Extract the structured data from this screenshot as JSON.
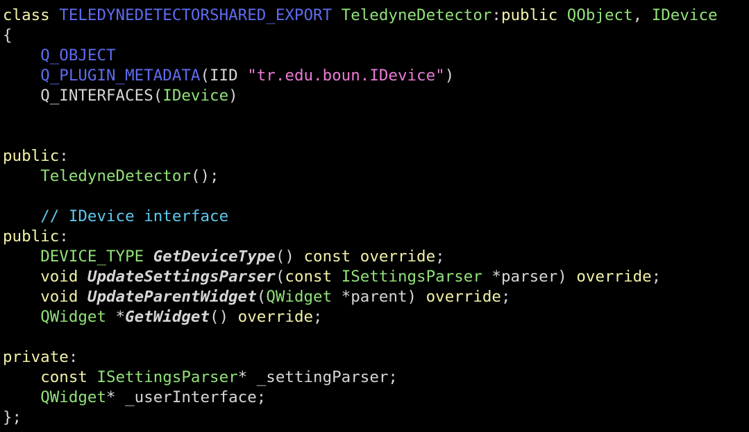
{
  "editor": {
    "colors": {
      "background": "#000000",
      "keyword": "#f4f1a8",
      "macro": "#5f6cf0",
      "type": "#92e27a",
      "string": "#e97bd6",
      "comment": "#5ec8ee",
      "plain": "#d6d6d6"
    },
    "lines": [
      [
        {
          "t": "class",
          "c": "keyword"
        },
        {
          "t": " ",
          "c": "plain"
        },
        {
          "t": "TELEDYNEDETECTORSHARED_EXPORT",
          "c": "macro"
        },
        {
          "t": " ",
          "c": "plain"
        },
        {
          "t": "TeledyneDetector",
          "c": "type"
        },
        {
          "t": ":",
          "c": "plain"
        },
        {
          "t": "public",
          "c": "keyword"
        },
        {
          "t": " ",
          "c": "plain"
        },
        {
          "t": "QObject",
          "c": "type"
        },
        {
          "t": ", ",
          "c": "plain"
        },
        {
          "t": "IDevice",
          "c": "type"
        }
      ],
      [
        {
          "t": "{",
          "c": "plain"
        }
      ],
      [
        {
          "t": "    ",
          "c": "plain"
        },
        {
          "t": "Q_OBJECT",
          "c": "macro"
        }
      ],
      [
        {
          "t": "    ",
          "c": "plain"
        },
        {
          "t": "Q_PLUGIN_METADATA",
          "c": "macro"
        },
        {
          "t": "(IID ",
          "c": "plain"
        },
        {
          "t": "\"tr.edu.boun.IDevice\"",
          "c": "string"
        },
        {
          "t": ")",
          "c": "plain"
        }
      ],
      [
        {
          "t": "    ",
          "c": "plain"
        },
        {
          "t": "Q_INTERFACES(",
          "c": "plain"
        },
        {
          "t": "IDevice",
          "c": "type"
        },
        {
          "t": ")",
          "c": "plain"
        }
      ],
      [],
      [],
      [
        {
          "t": "public",
          "c": "keyword"
        },
        {
          "t": ":",
          "c": "plain"
        }
      ],
      [
        {
          "t": "    ",
          "c": "plain"
        },
        {
          "t": "TeledyneDetector",
          "c": "type"
        },
        {
          "t": "();",
          "c": "plain"
        }
      ],
      [],
      [
        {
          "t": "    ",
          "c": "plain"
        },
        {
          "t": "// IDevice interface",
          "c": "comment"
        }
      ],
      [
        {
          "t": "public",
          "c": "keyword"
        },
        {
          "t": ":",
          "c": "plain"
        }
      ],
      [
        {
          "t": "    ",
          "c": "plain"
        },
        {
          "t": "DEVICE_TYPE",
          "c": "type"
        },
        {
          "t": " ",
          "c": "plain"
        },
        {
          "t": "GetDeviceType",
          "c": "plain",
          "s": "bi"
        },
        {
          "t": "() ",
          "c": "plain"
        },
        {
          "t": "const",
          "c": "keyword"
        },
        {
          "t": " ",
          "c": "plain"
        },
        {
          "t": "override",
          "c": "keyword"
        },
        {
          "t": ";",
          "c": "plain"
        }
      ],
      [
        {
          "t": "    ",
          "c": "plain"
        },
        {
          "t": "void",
          "c": "keyword"
        },
        {
          "t": " ",
          "c": "plain"
        },
        {
          "t": "UpdateSettingsParser",
          "c": "plain",
          "s": "bi"
        },
        {
          "t": "(",
          "c": "plain"
        },
        {
          "t": "const",
          "c": "keyword"
        },
        {
          "t": " ",
          "c": "plain"
        },
        {
          "t": "ISettingsParser",
          "c": "type"
        },
        {
          "t": " *parser) ",
          "c": "plain"
        },
        {
          "t": "override",
          "c": "keyword"
        },
        {
          "t": ";",
          "c": "plain"
        }
      ],
      [
        {
          "t": "    ",
          "c": "plain"
        },
        {
          "t": "void",
          "c": "keyword"
        },
        {
          "t": " ",
          "c": "plain"
        },
        {
          "t": "UpdateParentWidget",
          "c": "plain",
          "s": "bi"
        },
        {
          "t": "(",
          "c": "plain"
        },
        {
          "t": "QWidget",
          "c": "type"
        },
        {
          "t": " *parent) ",
          "c": "plain"
        },
        {
          "t": "override",
          "c": "keyword"
        },
        {
          "t": ";",
          "c": "plain"
        }
      ],
      [
        {
          "t": "    ",
          "c": "plain"
        },
        {
          "t": "QWidget",
          "c": "type"
        },
        {
          "t": " *",
          "c": "plain"
        },
        {
          "t": "GetWidget",
          "c": "plain",
          "s": "bi"
        },
        {
          "t": "() ",
          "c": "plain"
        },
        {
          "t": "override",
          "c": "keyword"
        },
        {
          "t": ";",
          "c": "plain"
        }
      ],
      [],
      [
        {
          "t": "private",
          "c": "keyword"
        },
        {
          "t": ":",
          "c": "plain"
        }
      ],
      [
        {
          "t": "    ",
          "c": "plain"
        },
        {
          "t": "const",
          "c": "keyword"
        },
        {
          "t": " ",
          "c": "plain"
        },
        {
          "t": "ISettingsParser",
          "c": "type"
        },
        {
          "t": "* _settingParser;",
          "c": "plain"
        }
      ],
      [
        {
          "t": "    ",
          "c": "plain"
        },
        {
          "t": "QWidget",
          "c": "type"
        },
        {
          "t": "* _userInterface;",
          "c": "plain"
        }
      ],
      [
        {
          "t": "};",
          "c": "plain"
        }
      ]
    ]
  }
}
